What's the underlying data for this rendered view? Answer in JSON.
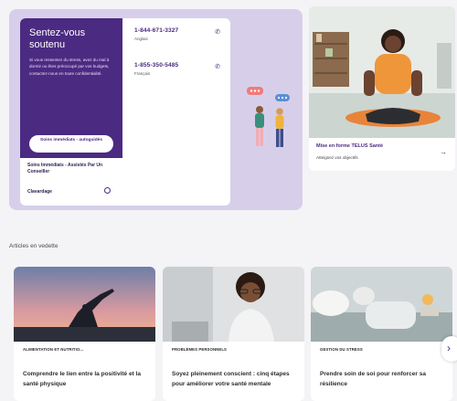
{
  "support": {
    "title": "Sentez-vous soutenu",
    "body": "Si vous ressentez du stress, avez du mal à dormir ou êtes préoccupé par vos budgets, contactez-nous en toute confidentialité.",
    "cta_label": "Soins immédiats - autoguidés",
    "secondary_link": "Soins Immédiats - Assistés Par Un Conseiller",
    "chat_label": "Clavardage",
    "phones": [
      {
        "number": "1-844-671-3327",
        "language": "Anglais"
      },
      {
        "number": "1-855-350-5485",
        "language": "Français"
      }
    ]
  },
  "fitness": {
    "title": "Mise en forme TELUS Santé",
    "subtitle": "Atteignez vos objectifs"
  },
  "articles_section": {
    "title": "Articles en vedette",
    "items": [
      {
        "tag": "ALIMENTATION ET NUTRITIO...",
        "title": "Comprendre le lien entre la positivité et la santé physique"
      },
      {
        "tag": "PROBLÈMES PERSONNELS",
        "title": "Soyez pleinement conscient : cinq étapes pour améliorer votre santé mentale"
      },
      {
        "tag": "GESTION DU STRESS",
        "title": "Prendre soin de soi pour renforcer sa résilience"
      }
    ]
  },
  "icons": {
    "phone": "phone-icon",
    "chat": "chat-icon",
    "arrow": "arrow-right-icon",
    "next": "chevron-right-icon"
  },
  "colors": {
    "brand_purple": "#4b2a82",
    "panel_lavender": "#d7cfea",
    "accent_green": "#5aa845"
  }
}
